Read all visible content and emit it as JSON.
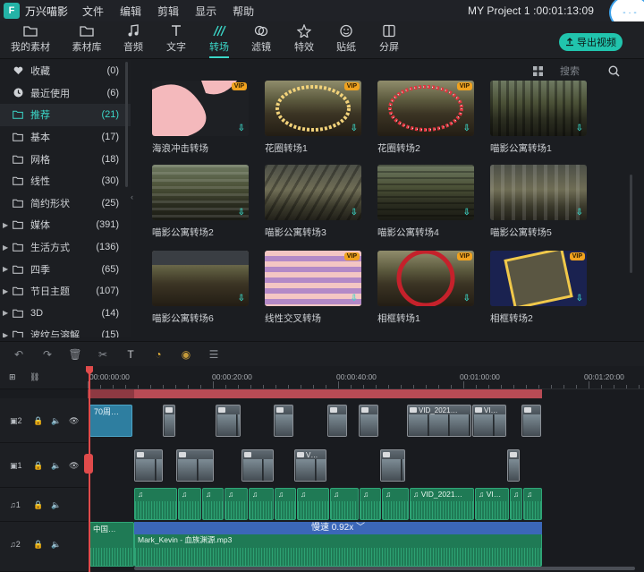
{
  "app": {
    "name": "万兴喵影",
    "logo_glyph": "F",
    "menu": [
      "文件",
      "编辑",
      "剪辑",
      "显示",
      "帮助"
    ],
    "project_title": "MY Project 1 :00:01:13:09",
    "badge_text": "- · -"
  },
  "toolbar": {
    "tabs": [
      {
        "label": "我的素材",
        "icon": "folder-icon"
      },
      {
        "label": "素材库",
        "icon": "folder-icon"
      },
      {
        "label": "音频",
        "icon": "music-icon"
      },
      {
        "label": "文字",
        "icon": "text-icon"
      },
      {
        "label": "转场",
        "icon": "transition-icon"
      },
      {
        "label": "滤镜",
        "icon": "filter-icon"
      },
      {
        "label": "特效",
        "icon": "effects-icon"
      },
      {
        "label": "贴纸",
        "icon": "sticker-icon"
      },
      {
        "label": "分屏",
        "icon": "split-screen-icon"
      }
    ],
    "active_tab": "转场",
    "export_label": "导出视频"
  },
  "sidebar": {
    "items": [
      {
        "label": "收藏",
        "count": "(0)",
        "icon": "heart-icon",
        "caret": ""
      },
      {
        "label": "最近使用",
        "count": "(6)",
        "icon": "clock-icon",
        "caret": ""
      },
      {
        "label": "推荐",
        "count": "(21)",
        "icon": "folder-icon",
        "caret": "",
        "selected": true
      },
      {
        "label": "基本",
        "count": "(17)",
        "icon": "folder-icon",
        "caret": ""
      },
      {
        "label": "网格",
        "count": "(18)",
        "icon": "folder-icon",
        "caret": ""
      },
      {
        "label": "线性",
        "count": "(30)",
        "icon": "folder-icon",
        "caret": ""
      },
      {
        "label": "简约形状",
        "count": "(25)",
        "icon": "folder-icon",
        "caret": ""
      },
      {
        "label": "媒体",
        "count": "(391)",
        "icon": "folder-icon",
        "caret": "▶"
      },
      {
        "label": "生活方式",
        "count": "(136)",
        "icon": "folder-icon",
        "caret": "▶"
      },
      {
        "label": "四季",
        "count": "(65)",
        "icon": "folder-icon",
        "caret": "▶"
      },
      {
        "label": "节日主题",
        "count": "(107)",
        "icon": "folder-icon",
        "caret": "▶"
      },
      {
        "label": "3D",
        "count": "(14)",
        "icon": "folder-icon",
        "caret": "▶"
      },
      {
        "label": "波纹与溶解",
        "count": "(15)",
        "icon": "folder-icon",
        "caret": "▶"
      }
    ]
  },
  "content": {
    "search_placeholder": "搜索",
    "vip_label": "VIP",
    "download_glyph": "⇩",
    "cards": [
      {
        "label": "海浪冲击转场",
        "vip": true
      },
      {
        "label": "花圈转场1",
        "vip": true
      },
      {
        "label": "花圈转场2",
        "vip": true
      },
      {
        "label": "喵影公寓转场1",
        "vip": false
      },
      {
        "label": "喵影公寓转场2",
        "vip": false
      },
      {
        "label": "喵影公寓转场3",
        "vip": false
      },
      {
        "label": "喵影公寓转场4",
        "vip": false
      },
      {
        "label": "喵影公寓转场5",
        "vip": false
      },
      {
        "label": "喵影公寓转场6",
        "vip": false
      },
      {
        "label": "线性交叉转场",
        "vip": true
      },
      {
        "label": "相框转场1",
        "vip": true
      },
      {
        "label": "相框转场2",
        "vip": true
      }
    ]
  },
  "timeline": {
    "ruler_labels": [
      "00:00:00:00",
      "00:00:20:00",
      "00:00:40:00",
      "00:01:00:00",
      "00:01:20:00"
    ],
    "tracks": [
      {
        "id": "2",
        "kind": "video"
      },
      {
        "id": "1",
        "kind": "video"
      },
      {
        "id": "1",
        "kind": "audio"
      },
      {
        "id": "2",
        "kind": "audio"
      }
    ],
    "text_clip": "70周…",
    "video_clip_titles": [
      "VID_2021…",
      "VI…",
      "V…"
    ],
    "audio_clip_titles": [
      "VID_2021…",
      "VI…",
      "V…"
    ],
    "music_clip_1": "中国…",
    "music_clip_2": "Mark_Kevin - 血族渊源.mp3",
    "speed_label": "慢速 0.92x"
  },
  "colors": {
    "accent": "#3bd8c9",
    "export_button": "#21c4ad",
    "playhead": "#e04b4b",
    "text_clip": "#2e7ea0",
    "audio_clip": "#1f7a55",
    "speed_bar": "#3b67b8",
    "vip_badge": "#f0a21f"
  }
}
